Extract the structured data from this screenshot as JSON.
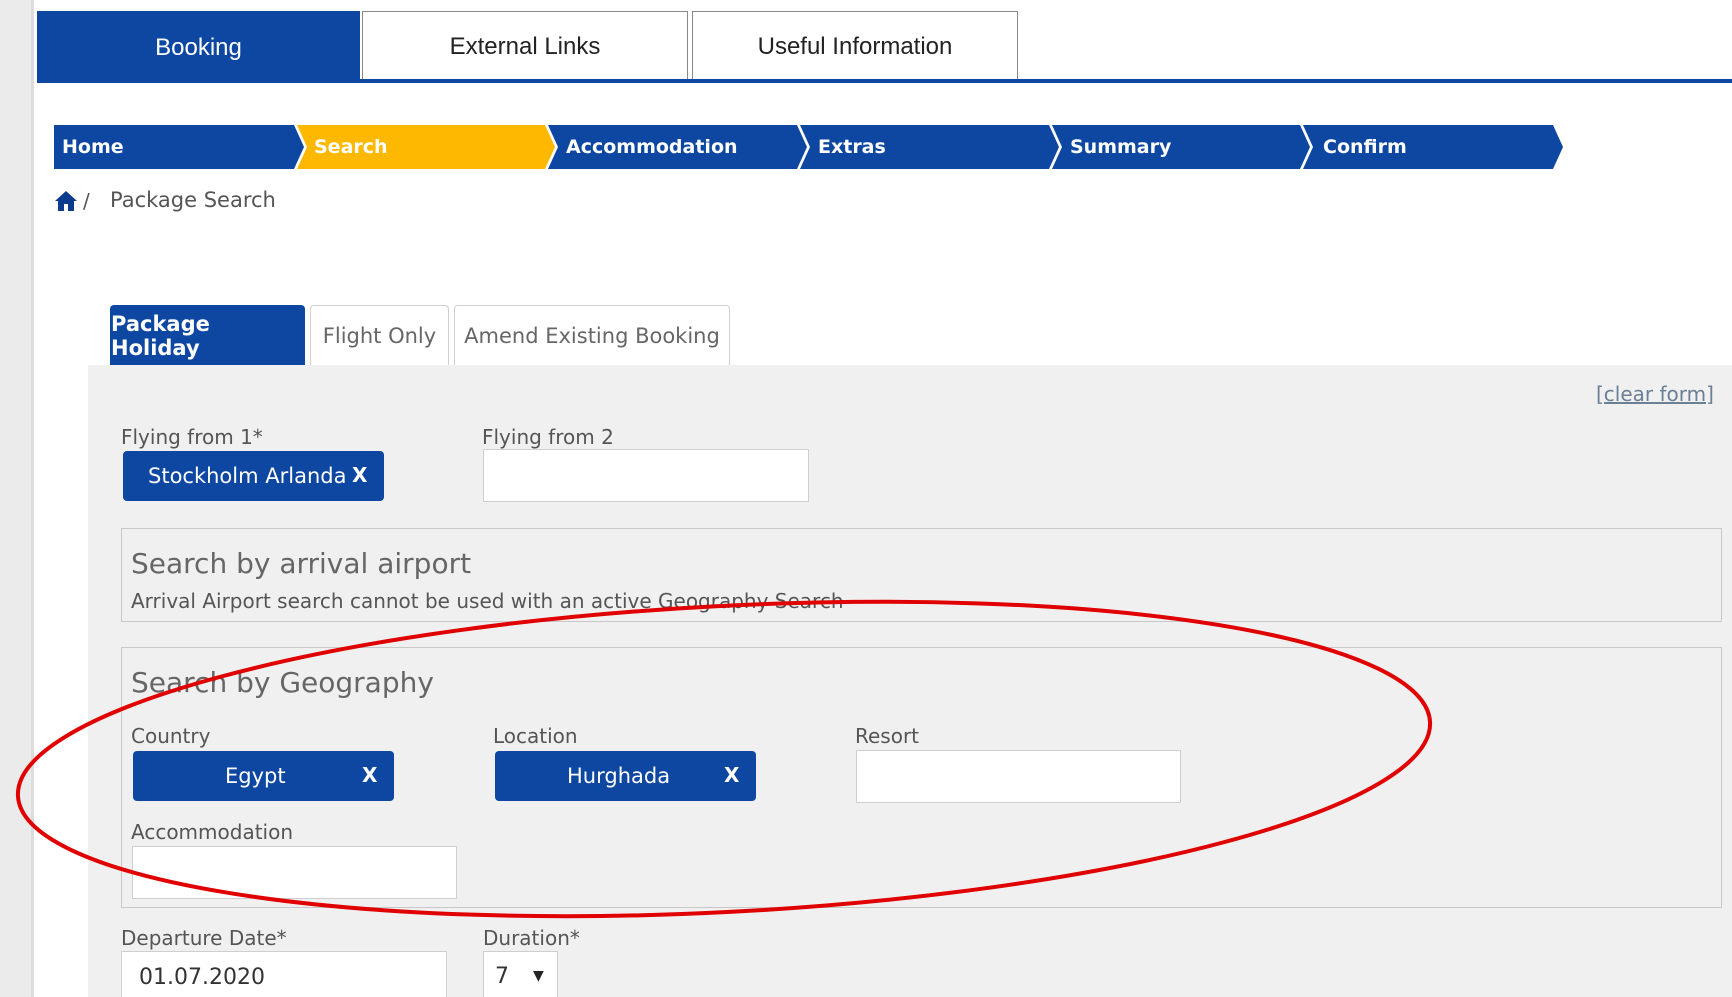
{
  "top_tabs": [
    {
      "label": "Booking"
    },
    {
      "label": "External Links"
    },
    {
      "label": "Useful Information"
    }
  ],
  "steps": [
    {
      "label": "Home"
    },
    {
      "label": "Search"
    },
    {
      "label": "Accommodation"
    },
    {
      "label": "Extras"
    },
    {
      "label": "Summary"
    },
    {
      "label": "Confirm"
    }
  ],
  "colors": {
    "brand_blue": "#0d47a1",
    "active_step": "#ffb800",
    "annotation_red": "#e00000",
    "panel_bg": "#f0f0f0"
  },
  "breadcrumb": {
    "home_icon": "home-icon",
    "separator": "/",
    "current": "Package Search"
  },
  "search_tabs": [
    {
      "label": "Package Holiday"
    },
    {
      "label": "Flight Only"
    },
    {
      "label": "Amend Existing Booking"
    }
  ],
  "form": {
    "clear_label": "[clear form]",
    "flying_from_1": {
      "label": "Flying from 1*",
      "chip": "Stockholm Arlanda",
      "remove": "X"
    },
    "flying_from_2": {
      "label": "Flying from 2",
      "value": ""
    },
    "arrival_airport": {
      "title": "Search by arrival airport",
      "note": "Arrival Airport search cannot be used with an active Geography Search"
    },
    "geography": {
      "title": "Search by Geography",
      "country": {
        "label": "Country",
        "chip": "Egypt",
        "remove": "X"
      },
      "location": {
        "label": "Location",
        "chip": "Hurghada",
        "remove": "X"
      },
      "resort": {
        "label": "Resort",
        "value": ""
      },
      "accommodation": {
        "label": "Accommodation",
        "value": ""
      }
    },
    "departure_date": {
      "label": "Departure Date*",
      "value": "01.07.2020"
    },
    "duration": {
      "label": "Duration*",
      "value": "7",
      "arrow": "▼"
    }
  }
}
